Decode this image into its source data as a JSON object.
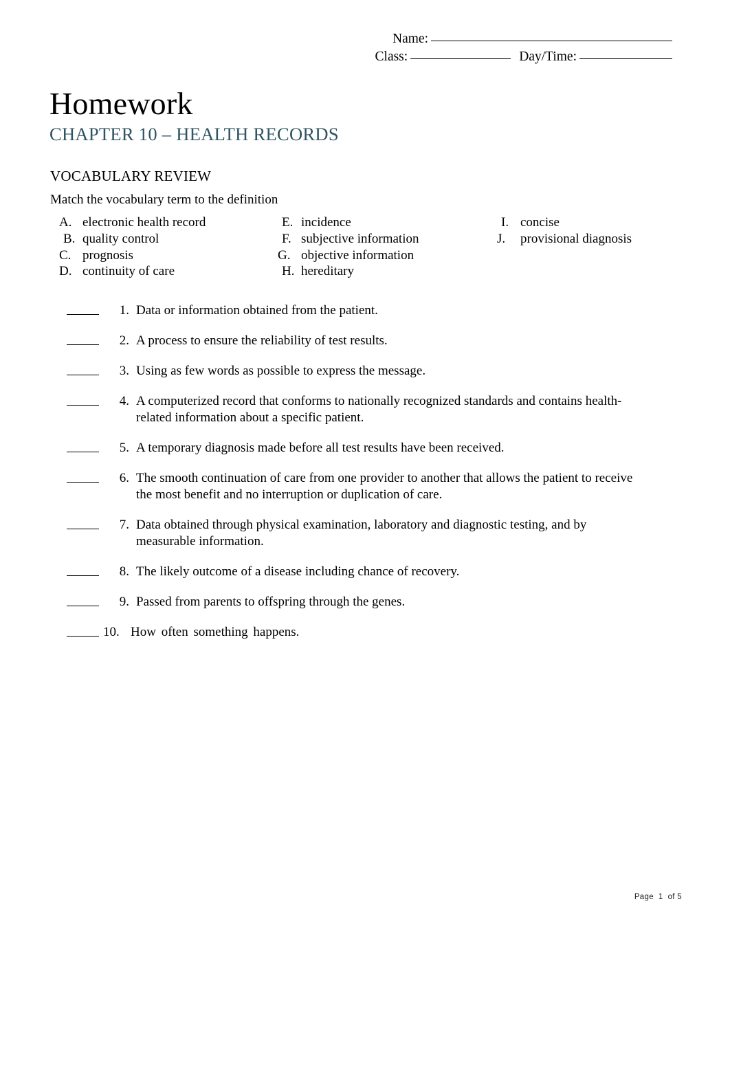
{
  "header": {
    "name_label": "Name:",
    "class_label": "Class:",
    "daytime_label": "Day/Time:"
  },
  "title": "Homework",
  "subtitle": "CHAPTER 10 – HEALTH RECORDS",
  "subtitle_color": "#2e5361",
  "section": {
    "heading": "VOCABULARY REVIEW",
    "instruction": "Match the vocabulary term to the definition"
  },
  "vocabulary": {
    "col1": [
      {
        "letter": "A.",
        "term": "electronic health record"
      },
      {
        "letter": "B.",
        "term": "quality control"
      },
      {
        "letter": "C.",
        "term": "prognosis"
      },
      {
        "letter": "D.",
        "term": "continuity of care"
      }
    ],
    "col2": [
      {
        "letter": "E.",
        "term": "incidence"
      },
      {
        "letter": "F.",
        "term": "subjective information"
      },
      {
        "letter": "G.",
        "term": "objective information"
      },
      {
        "letter": "H.",
        "term": "hereditary"
      }
    ],
    "col3": [
      {
        "letter": "I.",
        "term": "concise"
      },
      {
        "letter": "J.",
        "term": "provisional diagnosis"
      }
    ]
  },
  "questions": [
    {
      "num": "1.",
      "text": "Data or information obtained from the patient."
    },
    {
      "num": "2.",
      "text": "A process to ensure the reliability of test results."
    },
    {
      "num": "3.",
      "text": "Using as few words as possible to express the message."
    },
    {
      "num": "4.",
      "text": "A computerized record that conforms to nationally recognized standards and contains health-related information about a specific patient."
    },
    {
      "num": "5.",
      "text": "A temporary diagnosis made before all test results have been received."
    },
    {
      "num": "6.",
      "text": "The smooth continuation of care from one provider to another that allows the patient to receive the most benefit and no interruption or duplication of care."
    },
    {
      "num": "7.",
      "text": "Data obtained through physical examination, laboratory and diagnostic testing, and by measurable information."
    },
    {
      "num": "8.",
      "text": "The likely outcome of a disease including chance of recovery."
    },
    {
      "num": "9.",
      "text": "Passed from parents to offspring through the genes."
    },
    {
      "num": "10.",
      "text": "How often something happens."
    }
  ],
  "footer": {
    "page_word": "Page",
    "page_number": "1",
    "of_word": "of",
    "total_pages": "5"
  }
}
